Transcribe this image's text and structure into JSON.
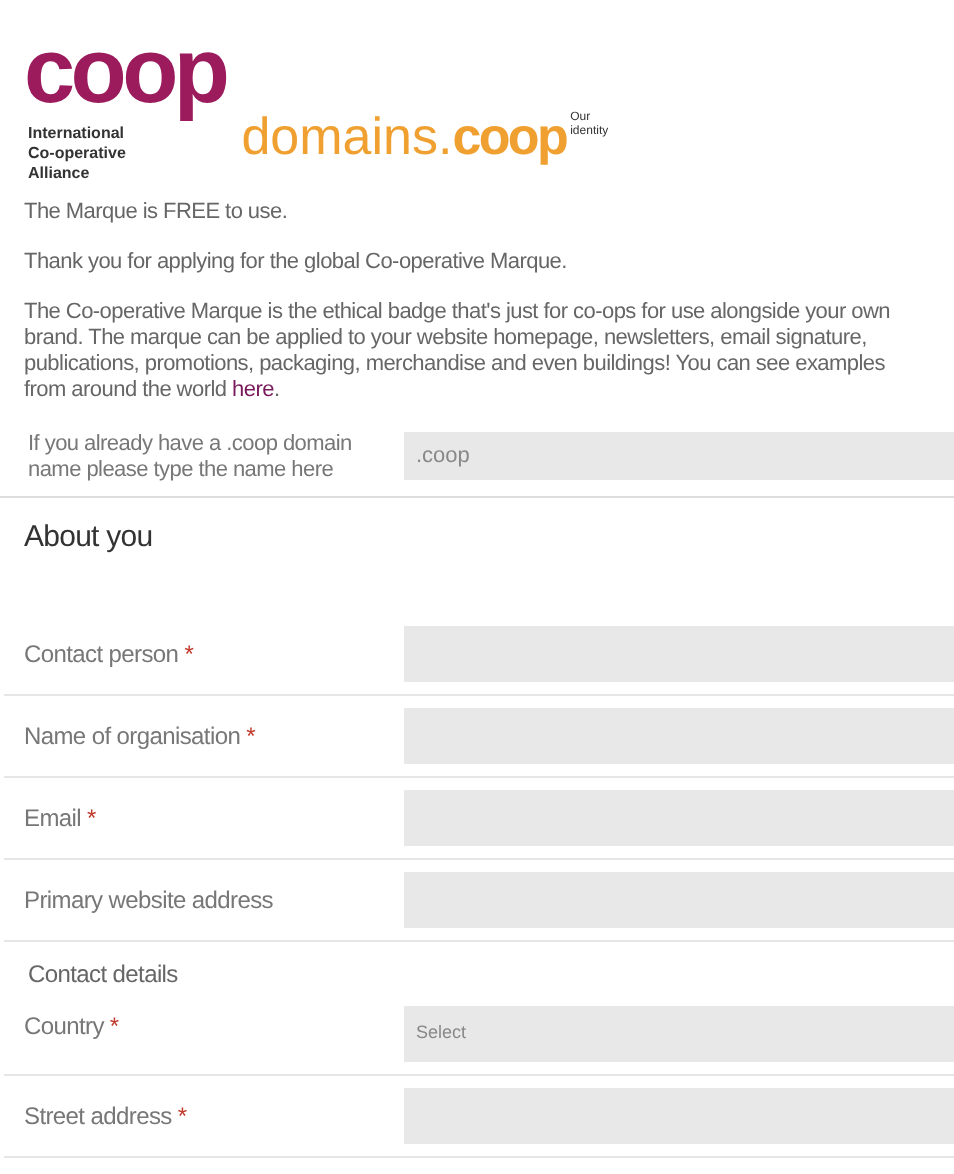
{
  "logo": {
    "mark": "coop",
    "alliance": [
      "International",
      "Co-operative",
      "Alliance"
    ],
    "domains_prefix": "domains.",
    "domains_mark": "coop",
    "tagline": [
      "Our",
      "identity"
    ]
  },
  "paragraphs": [
    "The Marque is FREE to use.",
    "Thank you for applying for the global Co-operative Marque.",
    "The Co-operative Marque is the ethical badge that's just for co-ops for use alongside your own brand. The marque can be applied to your website homepage, newsletters, email signature, publications, promotions, packaging, merchandise and even buildings! You can see examples from around the world "
  ],
  "link": "here",
  "link_suffix": ".",
  "domain_field": {
    "label": "If you already have a .coop domain name please type the name here",
    "placeholder": ".coop"
  },
  "section_title": "About you",
  "required_mark": "*",
  "fields": [
    {
      "label": "Contact person",
      "required": true,
      "kind": "text"
    },
    {
      "label": "Name of organisation",
      "required": true,
      "kind": "text"
    },
    {
      "label": "Email",
      "required": true,
      "kind": "text"
    },
    {
      "label": "Primary website address",
      "required": false,
      "kind": "text"
    }
  ],
  "subsection_title": "Contact details",
  "contact_fields": [
    {
      "label": "Country",
      "required": true,
      "kind": "select",
      "value": "Select"
    },
    {
      "label": "Street address",
      "required": true,
      "kind": "text"
    }
  ]
}
